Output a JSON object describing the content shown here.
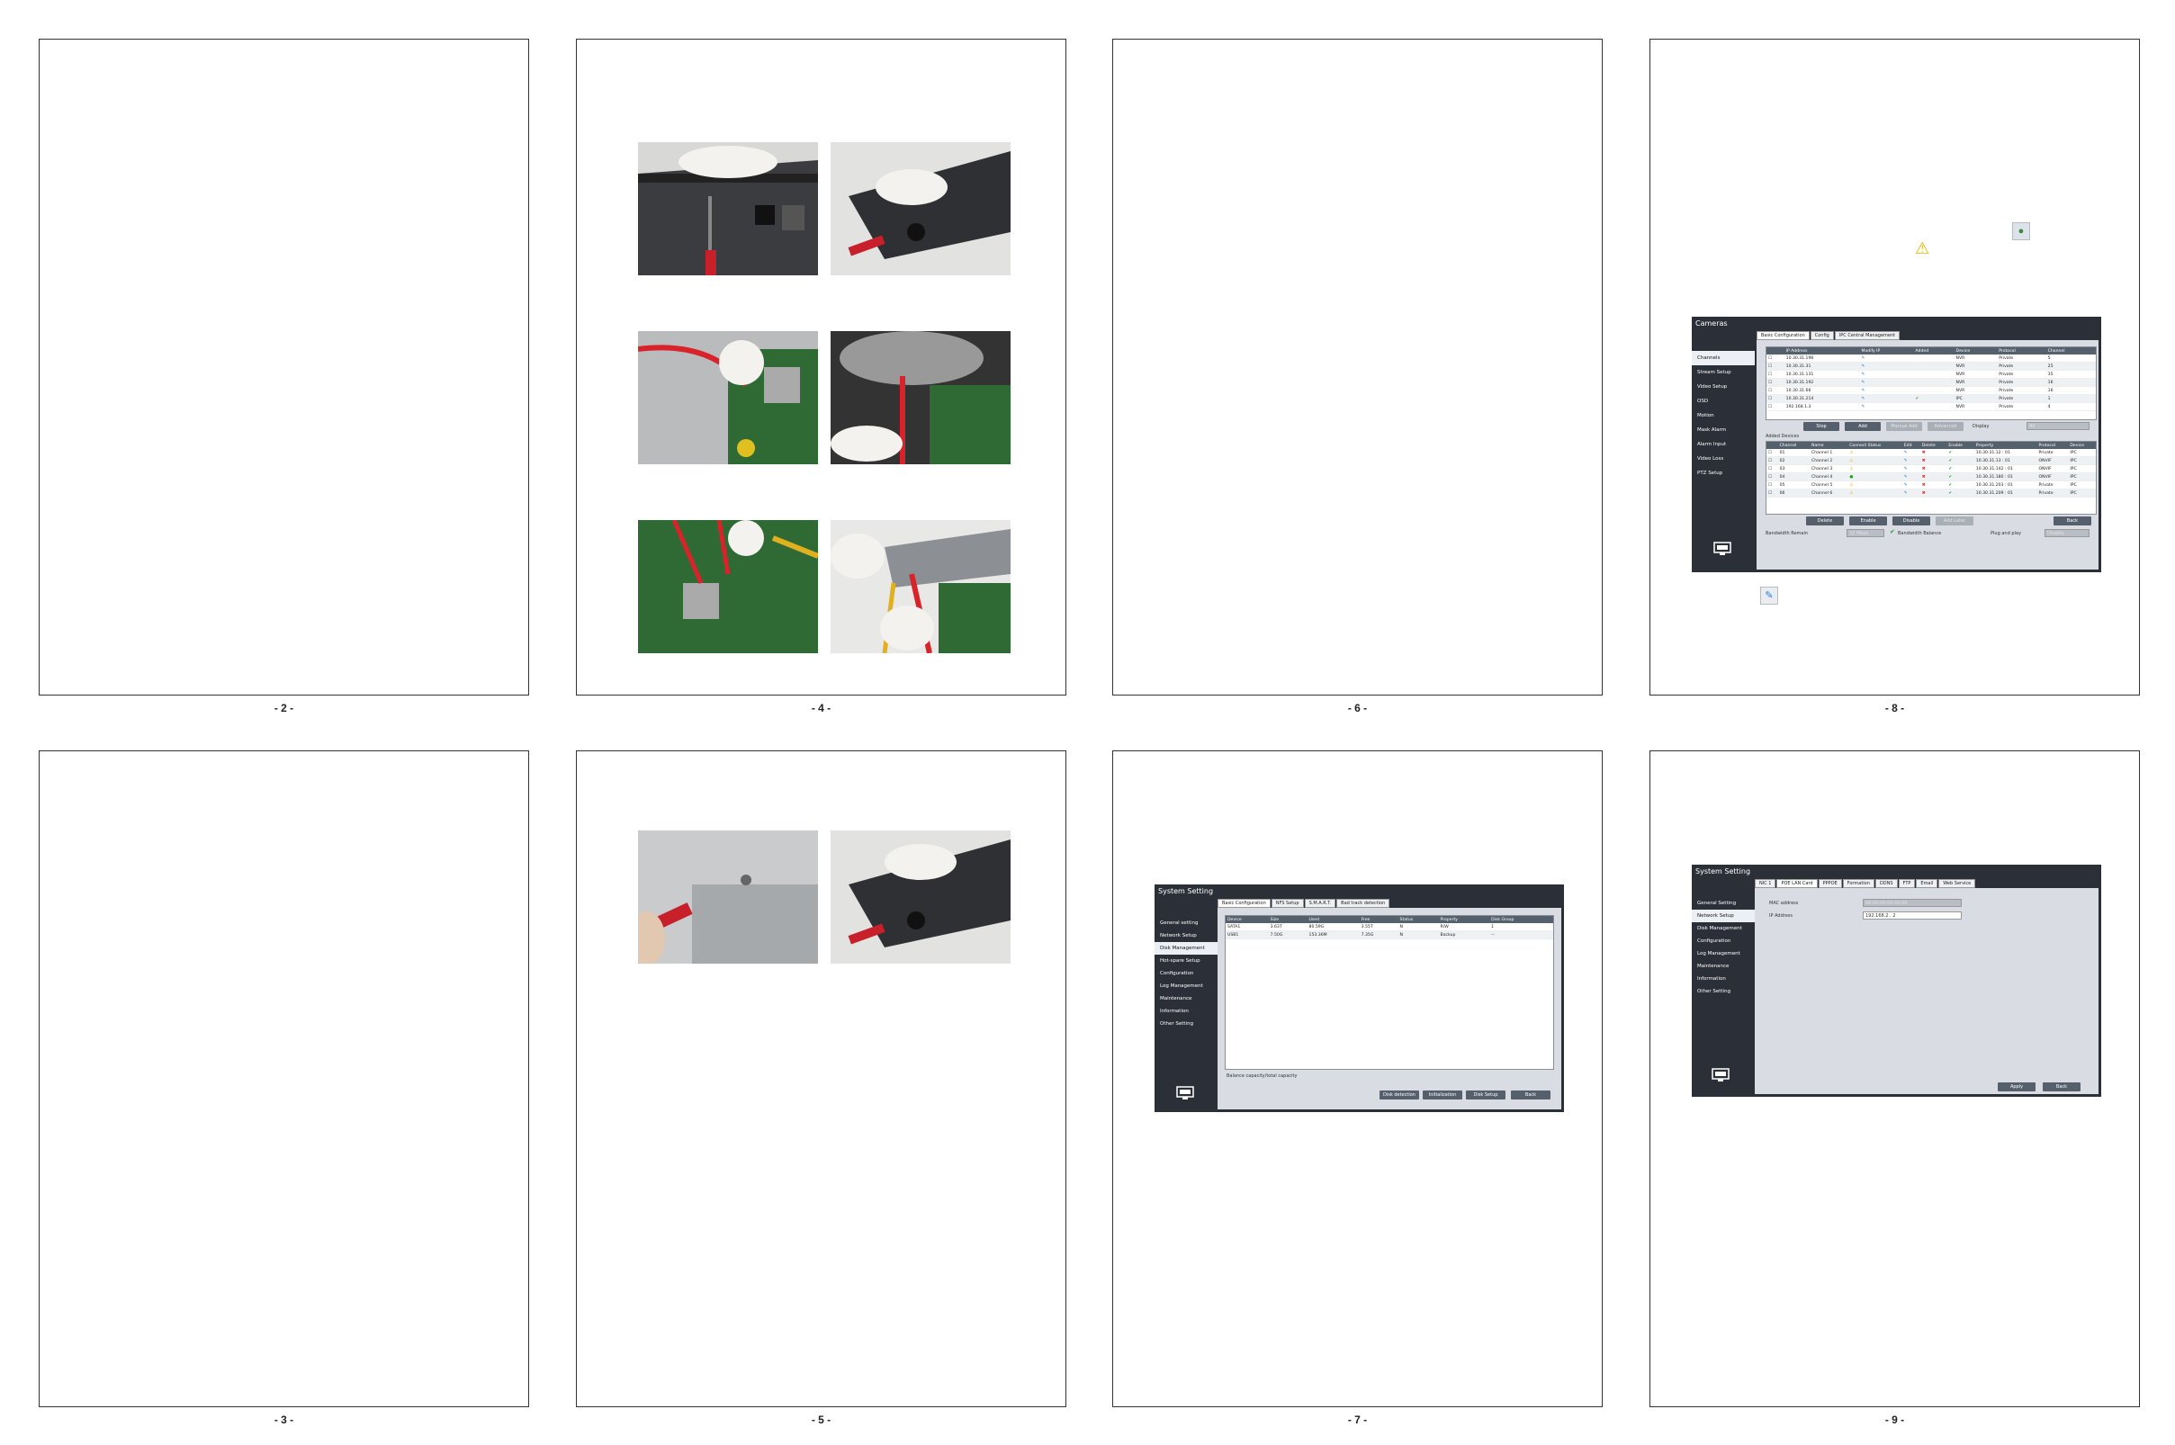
{
  "page_numbers": [
    "- 2 -",
    "- 4 -",
    "- 6 -",
    "- 8 -",
    "- 3 -",
    "- 5 -",
    "- 7 -",
    "- 9 -"
  ],
  "cameras": {
    "title": "Cameras",
    "tabs": [
      "Basic Configuration",
      "Config",
      "IPC Central Management"
    ],
    "sidebar": [
      "Channels",
      "Stream Setup",
      "Video Setup",
      "OSD",
      "Motion",
      "Mask Alarm",
      "Alarm Input",
      "Video Loss",
      "PTZ Setup"
    ],
    "search_headers": [
      "IP Address",
      "Modify IP",
      "Added",
      "Device",
      "Protocol",
      "Channel"
    ],
    "search_rows": [
      [
        "10.30.31.196",
        "",
        "",
        "NVR",
        "Private",
        "5"
      ],
      [
        "10.30.31.31",
        "",
        "",
        "NVR",
        "Private",
        "25"
      ],
      [
        "10.30.31.131",
        "",
        "",
        "NVR",
        "Private",
        "35"
      ],
      [
        "10.30.31.192",
        "",
        "",
        "NVR",
        "Private",
        "16"
      ],
      [
        "10.30.31.66",
        "",
        "",
        "NVR",
        "Private",
        "16"
      ],
      [
        "10.30.31.214",
        "",
        "",
        "IPC",
        "Private",
        "1"
      ],
      [
        "192.168.1.3",
        "",
        "",
        "NVR",
        "Private",
        "4"
      ]
    ],
    "search_buttons": [
      "Stop",
      "Add",
      "Manual Add",
      "Advanced"
    ],
    "display_label": "Display",
    "display_value": "All",
    "added_label": "Added Devices",
    "added_headers": [
      "Channel",
      "Name",
      "Connect Status",
      "Edit",
      "Delete",
      "Enable",
      "Property",
      "Protocol",
      "Device"
    ],
    "added_rows": [
      [
        "01",
        "Channel 1",
        "",
        "",
        "",
        "",
        "10.30.31.12 : 01",
        "Private",
        "IPC"
      ],
      [
        "02",
        "Channel 2",
        "",
        "",
        "",
        "",
        "10.30.31.13 : 01",
        "ONVIF",
        "IPC"
      ],
      [
        "03",
        "Channel 3",
        "",
        "",
        "",
        "",
        "10.30.31.142 : 01",
        "ONVIF",
        "IPC"
      ],
      [
        "04",
        "Channel 4",
        "",
        "",
        "",
        "",
        "10.30.31.180 : 01",
        "ONVIF",
        "IPC"
      ],
      [
        "05",
        "Channel 5",
        "",
        "",
        "",
        "",
        "10.30.31.203 : 01",
        "Private",
        "IPC"
      ],
      [
        "06",
        "Channel 6",
        "",
        "",
        "",
        "",
        "10.30.31.209 : 01",
        "Private",
        "IPC"
      ]
    ],
    "bottom_buttons": [
      "Delete",
      "Enable",
      "Disable",
      "Add Later",
      "Back"
    ],
    "bandwidth_remain_label": "Bandwidth Remain",
    "bandwidth_remain_value": "32 Mbps",
    "bandwidth_balance_label": "Bandwidth Balance",
    "plug_label": "Plug and play",
    "plug_value": "Disable"
  },
  "disk": {
    "title": "System Setting",
    "tabs": [
      "Basic Configuration",
      "NFS Setup",
      "S.M.A.R.T.",
      "Bad track detection"
    ],
    "sidebar": [
      "General setting",
      "Network Setup",
      "Disk Management",
      "Hot-spare Setup",
      "Configuration",
      "Log Management",
      "Maintenance",
      "Information",
      "Other Setting"
    ],
    "headers": [
      "Device",
      "Size",
      "Used",
      "Free",
      "Status",
      "Property",
      "Disk Group"
    ],
    "rows": [
      [
        "SATA1",
        "3.63T",
        "80.59G",
        "3.55T",
        "N",
        "R/W",
        "1"
      ],
      [
        "USB1",
        "7.50G",
        "153.36M",
        "7.35G",
        "N",
        "Backup",
        "--"
      ]
    ],
    "footer_text": "Balance capacity/total capacity",
    "buttons": [
      "Disk detection",
      "Initialization",
      "Disk Setup",
      "Back"
    ]
  },
  "network": {
    "title": "System Setting",
    "tabs": [
      "NIC 1",
      "POE LAN Card",
      "PPPOE",
      "Formation",
      "DDNS",
      "FTP",
      "Email",
      "Web Service"
    ],
    "sidebar": [
      "General Setting",
      "Network Setup",
      "Disk Management",
      "Configuration",
      "Log Management",
      "Maintenance",
      "Information",
      "Other Setting"
    ],
    "mac_label": "MAC address",
    "mac_value": "00:00:00:00:00:00",
    "ip_label": "IP Address",
    "ip_value": "192.168.2 . 2",
    "buttons": [
      "Apply",
      "Back"
    ]
  }
}
